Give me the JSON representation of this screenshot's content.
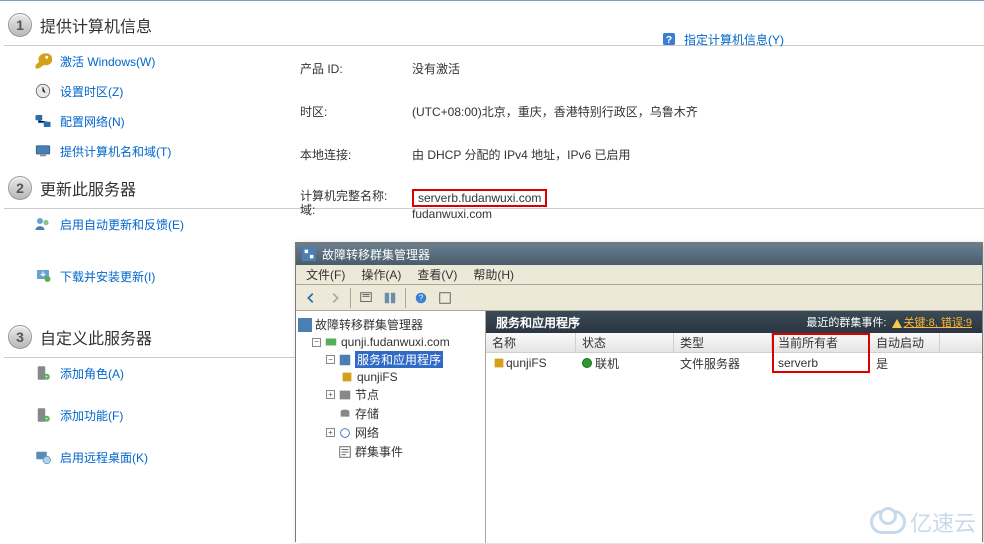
{
  "sections": {
    "s1": {
      "title": "提供计算机信息"
    },
    "s2": {
      "title": "更新此服务器"
    },
    "s3": {
      "title": "自定义此服务器"
    }
  },
  "links": {
    "activate": "激活 Windows(W)",
    "timezone": "设置时区(Z)",
    "network": "配置网络(N)",
    "computerName": "提供计算机名和域(T)",
    "updates": "启用自动更新和反馈(E)",
    "download": "下载并安装更新(I)",
    "addRoles": "添加角色(A)",
    "addFeatures": "添加功能(F)",
    "remoteDesktop": "启用远程桌面(K)"
  },
  "help": {
    "label": "指定计算机信息(Y)"
  },
  "info": {
    "productIdLabel": "产品 ID:",
    "productIdValue": "没有激活",
    "tzLabel": "时区:",
    "tzValue": "(UTC+08:00)北京，重庆，香港特别行政区，乌鲁木齐",
    "connLabel": "本地连接:",
    "connValue": "由 DHCP 分配的 IPv4 地址，IPv6 已启用",
    "fqdnLabel": "计算机完整名称:",
    "fqdnValue": "serverb.fudanwuxi.com",
    "domainLabel": "域:",
    "domainValue": "fudanwuxi.com"
  },
  "cluster": {
    "title": "故障转移群集管理器",
    "menu": {
      "file": "文件(F)",
      "action": "操作(A)",
      "view": "查看(V)",
      "help": "帮助(H)"
    },
    "tree": {
      "root": "故障转移群集管理器",
      "cluster": "qunji.fudanwuxi.com",
      "services": "服务和应用程序",
      "qunjifs": "qunjiFS",
      "nodes": "节点",
      "storage": "存储",
      "networks": "网络",
      "events": "群集事件"
    },
    "list": {
      "headerTitle": "服务和应用程序",
      "recentLabel": "最近的群集事件:",
      "recentLinks": "关键:8, 错误:9",
      "cols": {
        "name": "名称",
        "state": "状态",
        "type": "类型",
        "owner": "当前所有者",
        "auto": "自动启动"
      },
      "row": {
        "name": "qunjiFS",
        "state": "联机",
        "type": "文件服务器",
        "owner": "serverb",
        "auto": "是"
      }
    }
  },
  "watermark": "亿速云"
}
